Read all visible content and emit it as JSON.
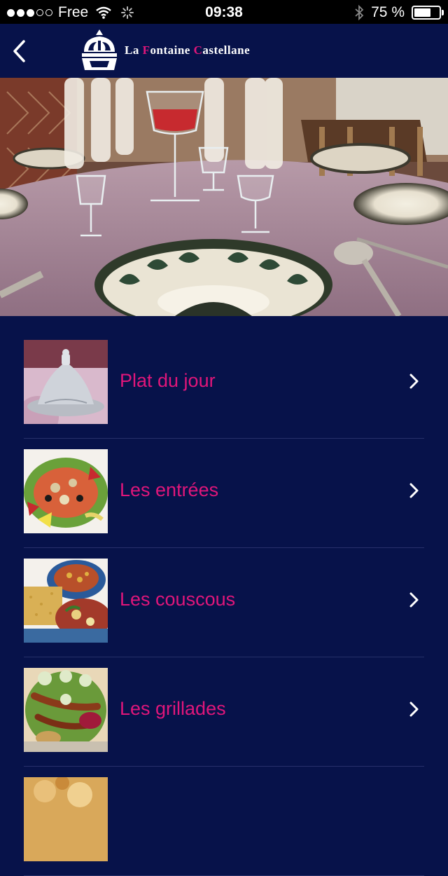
{
  "status_bar": {
    "carrier": "Free",
    "time": "09:38",
    "battery": "75 %",
    "battery_level": 0.75
  },
  "navbar": {
    "brand_letters": {
      "w1a": "La ",
      "w2a": "F",
      "w2b": "ontaine ",
      "w3a": "C",
      "w3b": "astellane"
    },
    "icons": [
      "back-chevron-icon",
      "fountain-logo-icon"
    ]
  },
  "menu": {
    "items": [
      {
        "label": "Plat du jour"
      },
      {
        "label": "Les entrées"
      },
      {
        "label": "Les couscous"
      },
      {
        "label": "Les grillades"
      },
      {
        "label": ""
      }
    ]
  },
  "colors": {
    "background": "#07124a",
    "accent": "#e0167a",
    "status_bar": "#000000"
  }
}
